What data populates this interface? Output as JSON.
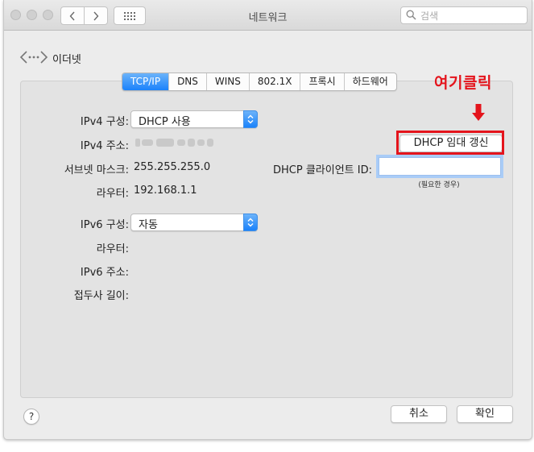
{
  "window": {
    "title": "네트워크"
  },
  "titlebar": {
    "back_icon": "chevron-left-icon",
    "forward_icon": "chevron-right-icon",
    "grid_icon": "grid-icon",
    "search_placeholder": "검색"
  },
  "interface": {
    "name": "이더넷",
    "icon": "ethernet-icon"
  },
  "tabs": [
    {
      "label": "TCP/IP",
      "active": true
    },
    {
      "label": "DNS",
      "active": false
    },
    {
      "label": "WINS",
      "active": false
    },
    {
      "label": "802.1X",
      "active": false
    },
    {
      "label": "프록시",
      "active": false
    },
    {
      "label": "하드웨어",
      "active": false
    }
  ],
  "tcpip": {
    "ipv4_config_label": "IPv4 구성:",
    "ipv4_config_value": "DHCP 사용",
    "ipv4_address_label": "IPv4 주소:",
    "subnet_label": "서브넷 마스크:",
    "subnet_value": "255.255.255.0",
    "router_label": "라우터:",
    "router_value": "192.168.1.1",
    "renew_button": "DHCP 임대 갱신",
    "client_id_label": "DHCP 클라이언트 ID:",
    "client_id_value": "",
    "client_id_hint": "(필요한 경우)",
    "ipv6_config_label": "IPv6 구성:",
    "ipv6_config_value": "자동",
    "ipv6_router_label": "라우터:",
    "ipv6_address_label": "IPv6 주소:",
    "prefix_length_label": "접두사 길이:"
  },
  "annotation": {
    "text": "여기클릭",
    "color": "#e4141c"
  },
  "footer": {
    "help_label": "?",
    "cancel_label": "취소",
    "ok_label": "확인"
  },
  "colors": {
    "accent": "#1a82fb",
    "annotation_red": "#e4141c"
  }
}
